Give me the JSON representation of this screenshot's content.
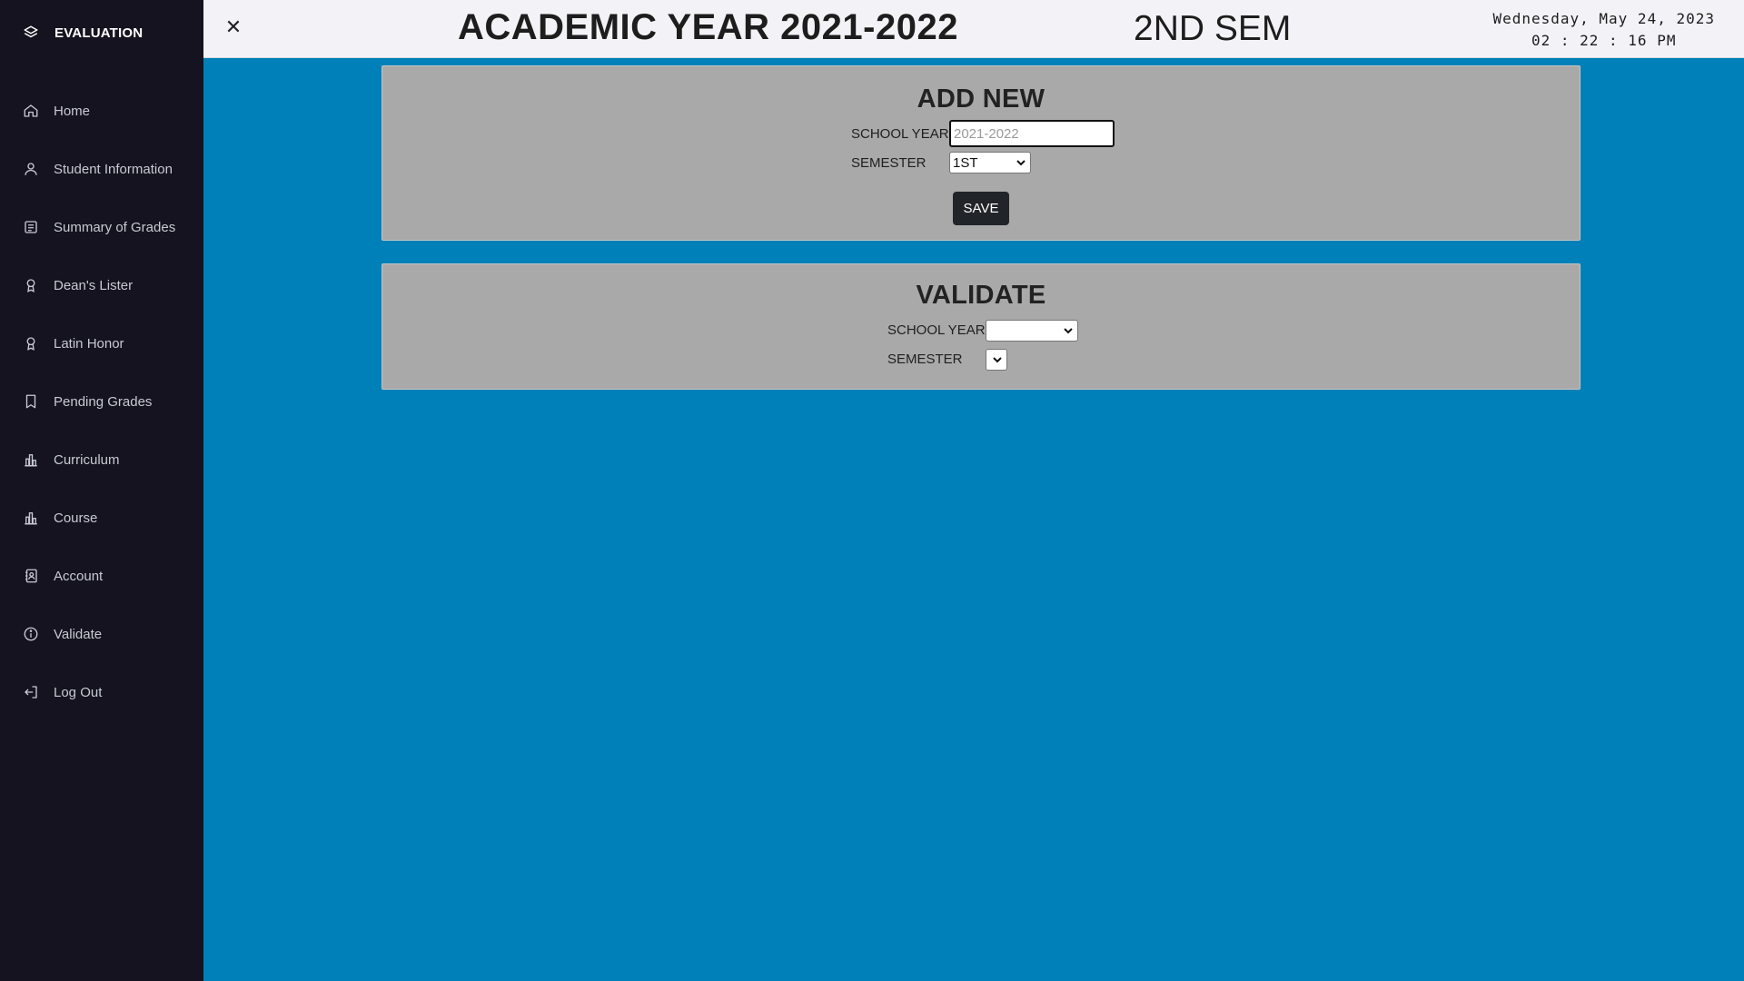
{
  "sidebar": {
    "brand": {
      "label": "EVALUATION",
      "icon": "layers-icon"
    },
    "items": [
      {
        "label": "Home",
        "icon": "home-icon"
      },
      {
        "label": "Student Information",
        "icon": "user-icon"
      },
      {
        "label": "Summary of Grades",
        "icon": "document-icon"
      },
      {
        "label": "Dean's Lister",
        "icon": "award-icon"
      },
      {
        "label": "Latin Honor",
        "icon": "award-icon"
      },
      {
        "label": "Pending Grades",
        "icon": "bookmark-icon"
      },
      {
        "label": "Curriculum",
        "icon": "bar-chart-icon"
      },
      {
        "label": "Course",
        "icon": "bar-chart-icon"
      },
      {
        "label": "Account",
        "icon": "contact-book-icon"
      },
      {
        "label": "Validate",
        "icon": "info-icon"
      },
      {
        "label": "Log Out",
        "icon": "logout-icon"
      }
    ]
  },
  "header": {
    "close_symbol": "✕",
    "academic_year": "ACADEMIC YEAR 2021-2022",
    "semester": "2ND SEM",
    "date": "Wednesday, May 24, 2023",
    "time": "02 : 22 : 16 PM"
  },
  "add_new": {
    "title": "ADD NEW",
    "school_year_label": "SCHOOL YEAR",
    "school_year_value": "",
    "school_year_placeholder": "2021-2022",
    "semester_label": "SEMESTER",
    "semester_selected": "1ST",
    "save_label": "SAVE"
  },
  "validate": {
    "title": "VALIDATE",
    "school_year_label": "SCHOOL YEAR",
    "school_year_selected": "",
    "semester_label": "SEMESTER",
    "semester_selected": ""
  },
  "colors": {
    "sidebar_bg": "#14131f",
    "content_bg": "#0080b8",
    "panel_bg": "#a9a9a9",
    "header_bg": "#f3f3f7",
    "button_bg": "#212529"
  }
}
